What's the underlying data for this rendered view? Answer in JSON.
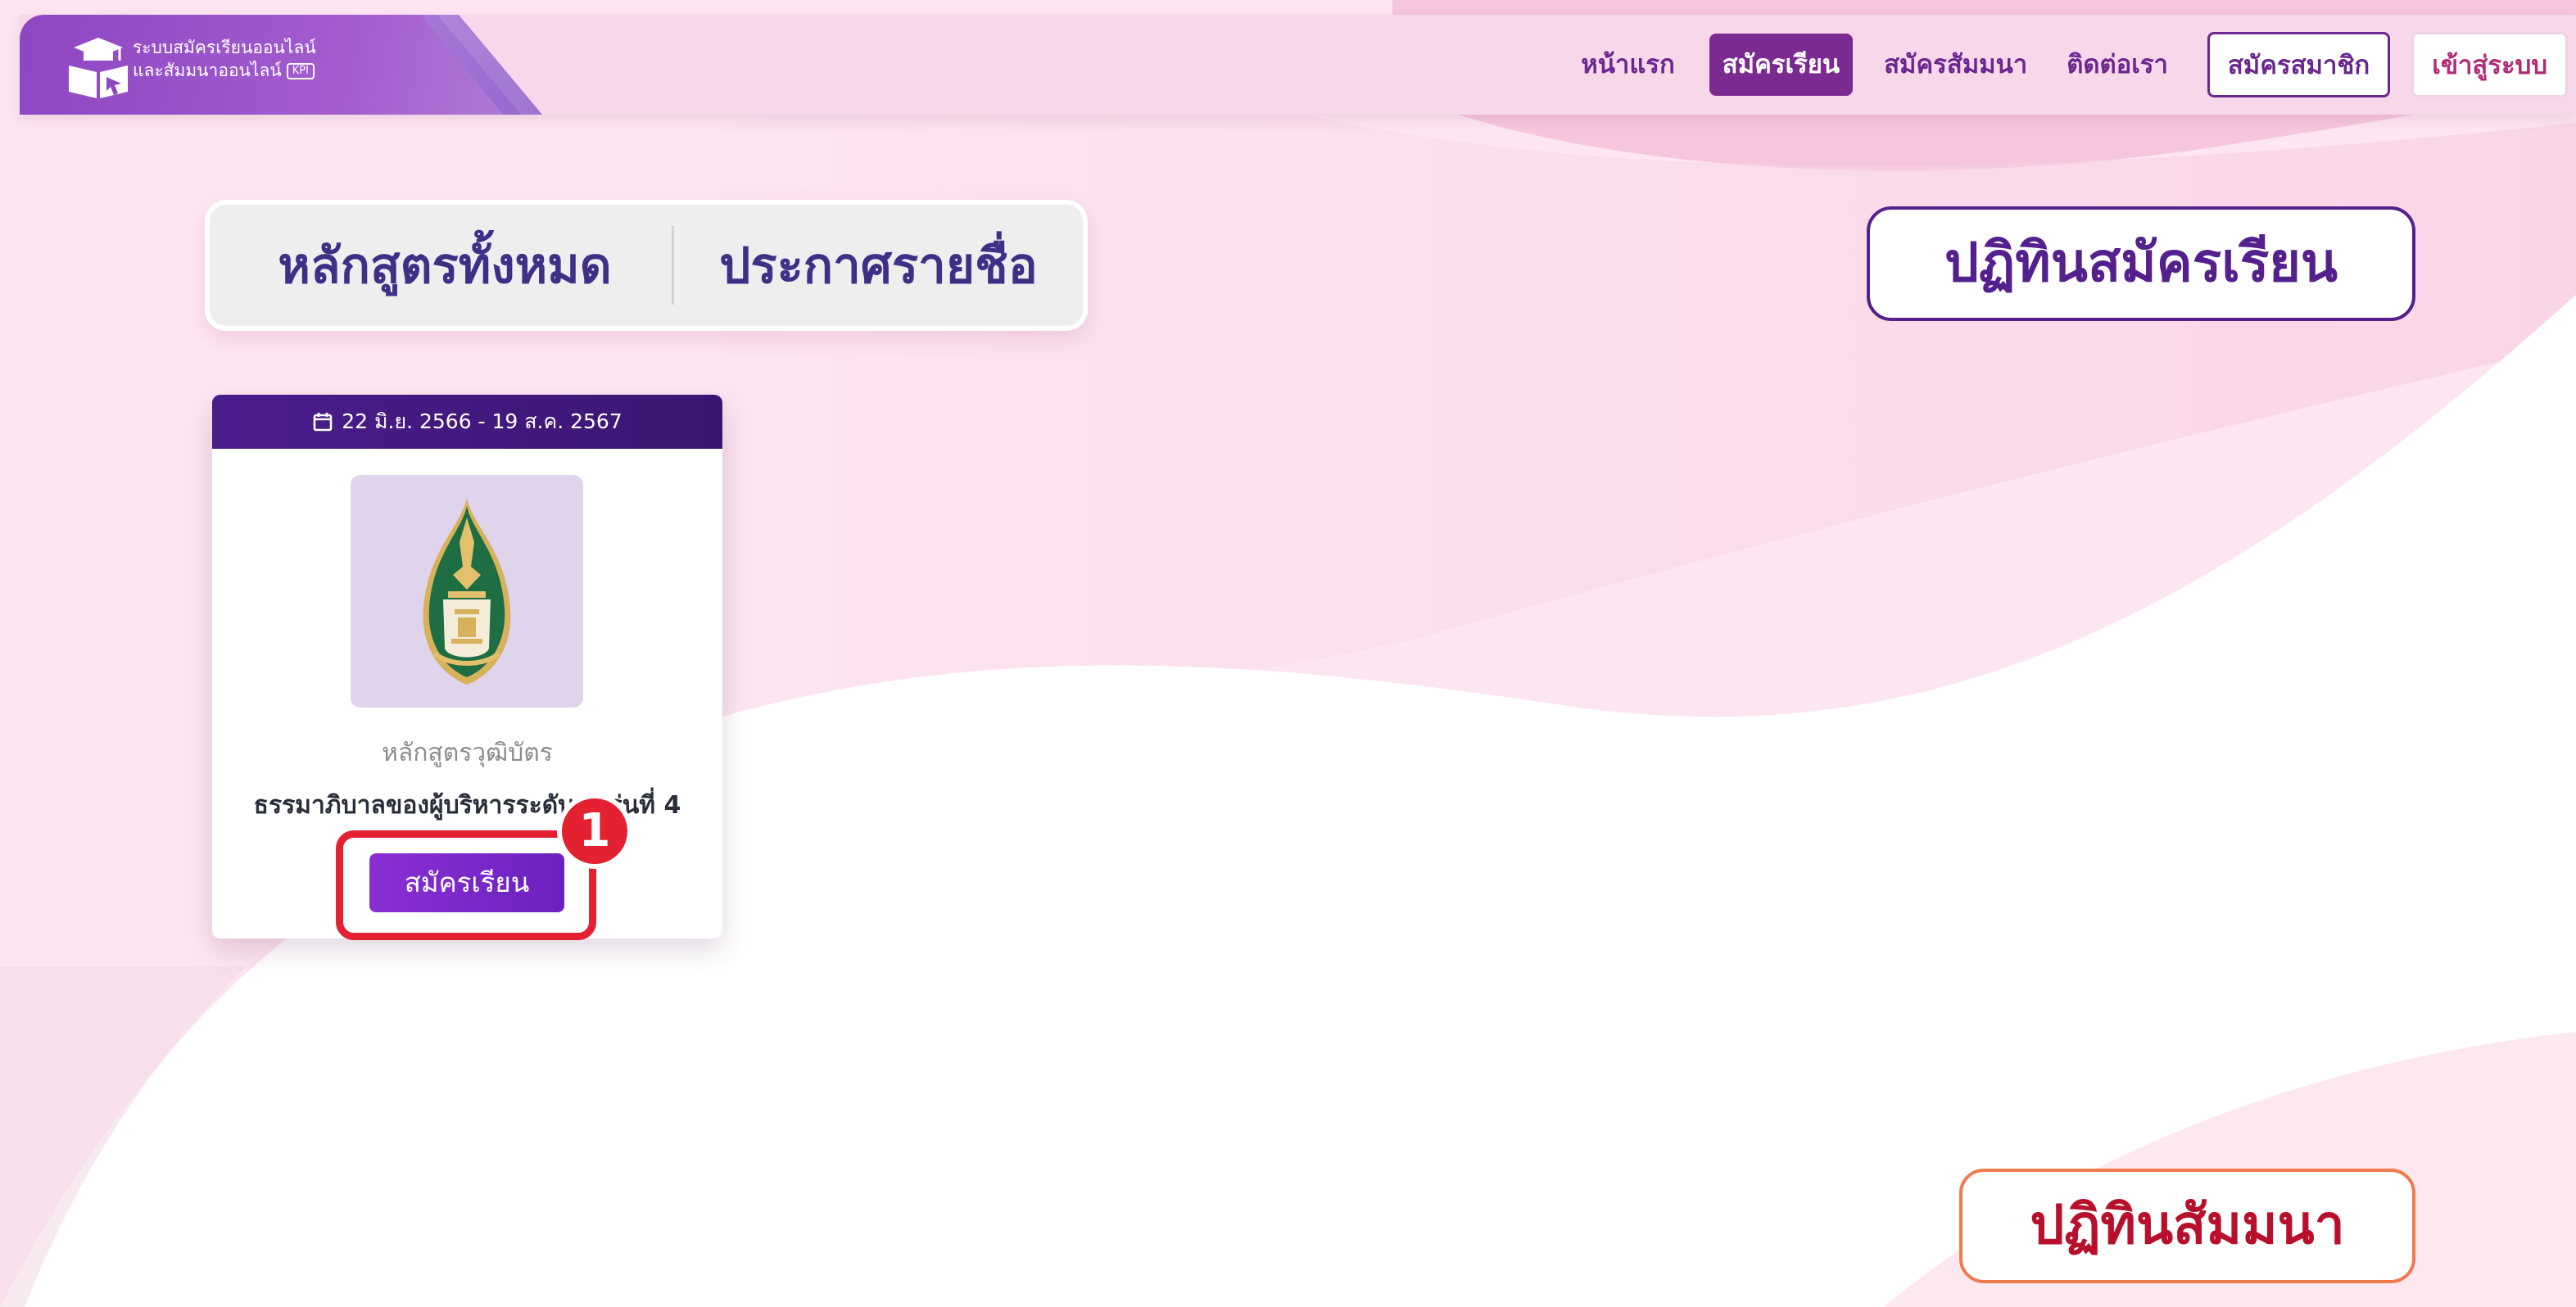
{
  "brand": {
    "line1": "ระบบสมัครเรียนออนไลน์",
    "line2": "และสัมมนาออนไลน์",
    "tag": "KPI"
  },
  "nav": {
    "links": [
      "หน้าแรก",
      "สมัครเรียน",
      "สมัครสัมมนา",
      "ติดต่อเรา"
    ],
    "active": "สมัครเรียน",
    "register_label": "สมัครสมาชิก",
    "login_label": "เข้าสู่ระบบ"
  },
  "tabs": {
    "all_courses": "หลักสูตรทั้งหมด",
    "announcement": "ประกาศรายชื่อ"
  },
  "calendar": {
    "course_label": "ปฏิทินสมัครเรียน",
    "seminar_label": "ปฏิทินสัมมนา"
  },
  "course_card": {
    "date_range": "22 มิ.ย. 2566 - 19 ส.ค. 2567",
    "type": "หลักสูตรวุฒิบัตร",
    "name": "ธรรมาภิบาลของผู้บริหารระดับสูง รุ่นที่ 4",
    "enroll_label": "สมัครเรียน",
    "image_icon": "institute-emblem-icon"
  },
  "annotation": {
    "step_number": "1"
  },
  "colors": {
    "brand_purple": "#8e46c2",
    "nav_active": "#7b2a91",
    "tab_text": "#3f2f87",
    "calendar_course_border": "#54208e",
    "calendar_seminar_border": "#ef7b4d",
    "calendar_seminar_text": "#b8102b",
    "enroll_button": "#7a28c8",
    "highlight_red": "#e32130"
  }
}
